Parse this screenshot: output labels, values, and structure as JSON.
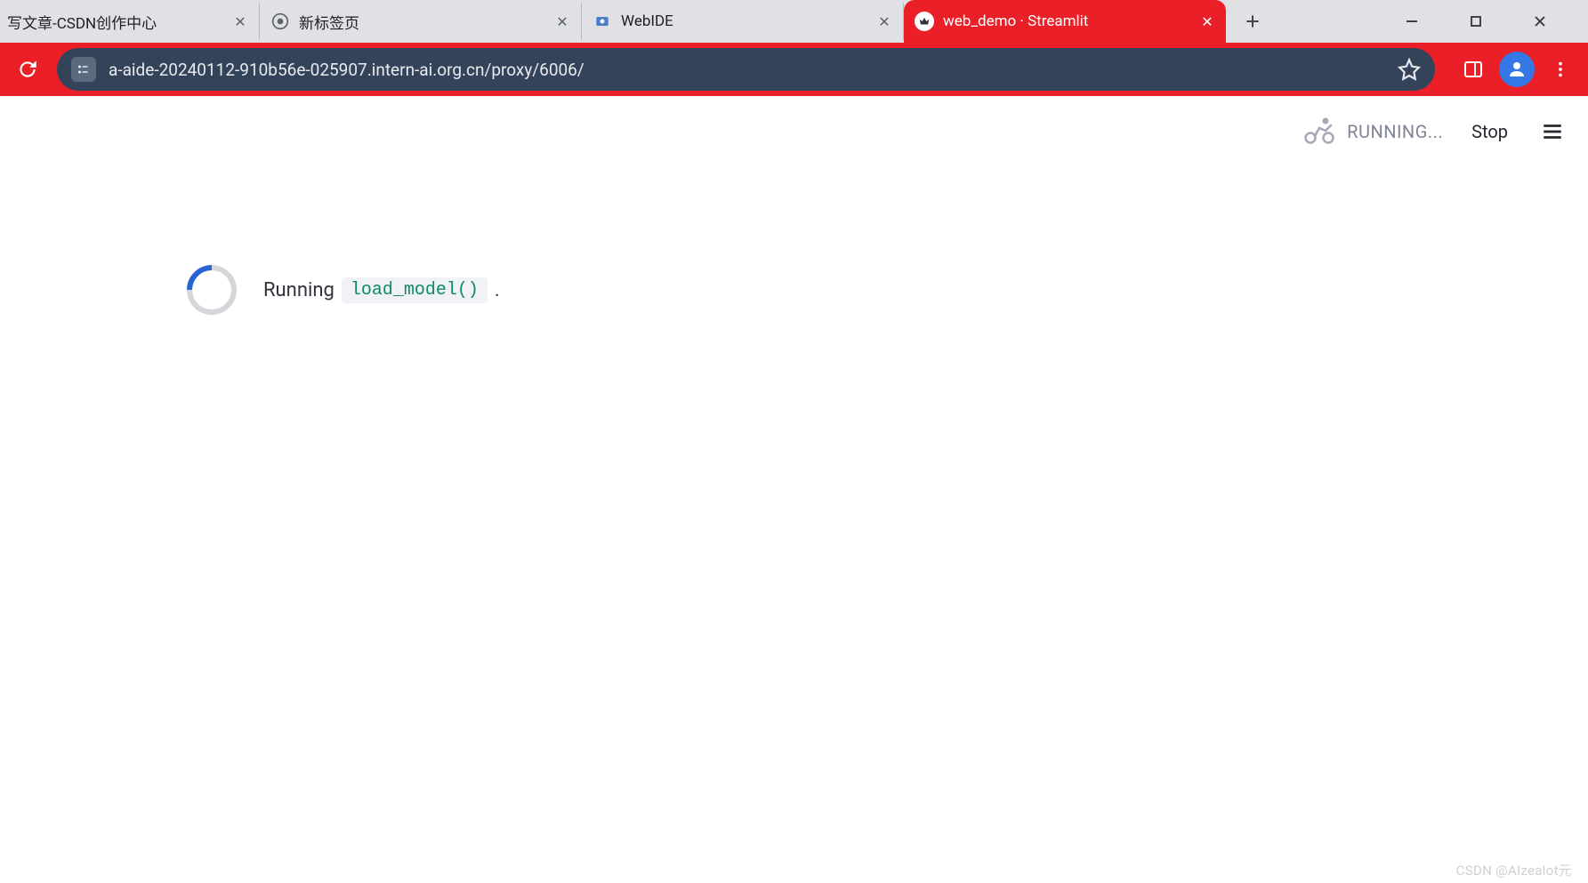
{
  "tabs": [
    {
      "title": "写文章-CSDN创作中心"
    },
    {
      "title": "新标签页"
    },
    {
      "title": "WebIDE"
    },
    {
      "title": "web_demo · Streamlit",
      "active": true
    }
  ],
  "url": "a-aide-20240112-910b56e-025907.intern-ai.org.cn/proxy/6006/",
  "streamlit": {
    "running_label": "RUNNING...",
    "stop_label": "Stop",
    "status": {
      "prefix": "Running",
      "code": "load_model()",
      "suffix": "."
    }
  },
  "watermark": "CSDN @AIzealot元"
}
